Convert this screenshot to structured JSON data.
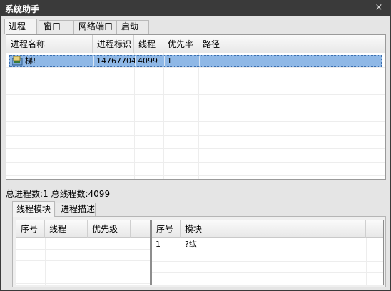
{
  "window": {
    "title": "系统助手",
    "close_glyph": "×"
  },
  "top_tabs": [
    {
      "label": "进程",
      "active": true
    },
    {
      "label": "窗口",
      "active": false
    },
    {
      "label": "网络端口",
      "active": false
    },
    {
      "label": "启动",
      "active": false
    }
  ],
  "process_table": {
    "columns": [
      "进程名称",
      "进程标识",
      "线程",
      "优先率",
      "路径"
    ],
    "rows": [
      {
        "name": "梯!",
        "pid": "14767704",
        "threads": "4099",
        "priority": "1",
        "path": "",
        "selected": true
      }
    ]
  },
  "status": {
    "text": "总进程数:1 总线程数:4099"
  },
  "bottom_tabs": [
    {
      "label": "线程模块",
      "active": true
    },
    {
      "label": "进程描述",
      "active": false
    }
  ],
  "thread_table": {
    "columns": [
      "序号",
      "线程",
      "优先级"
    ],
    "rows": []
  },
  "module_table": {
    "columns": [
      "序号",
      "模块"
    ],
    "rows": [
      {
        "index": "1",
        "module": "?纮"
      }
    ]
  },
  "colors": {
    "title_bar": "#3a3a3a",
    "selection": "#8fb8e6",
    "window_bg": "#e5e5e5"
  }
}
